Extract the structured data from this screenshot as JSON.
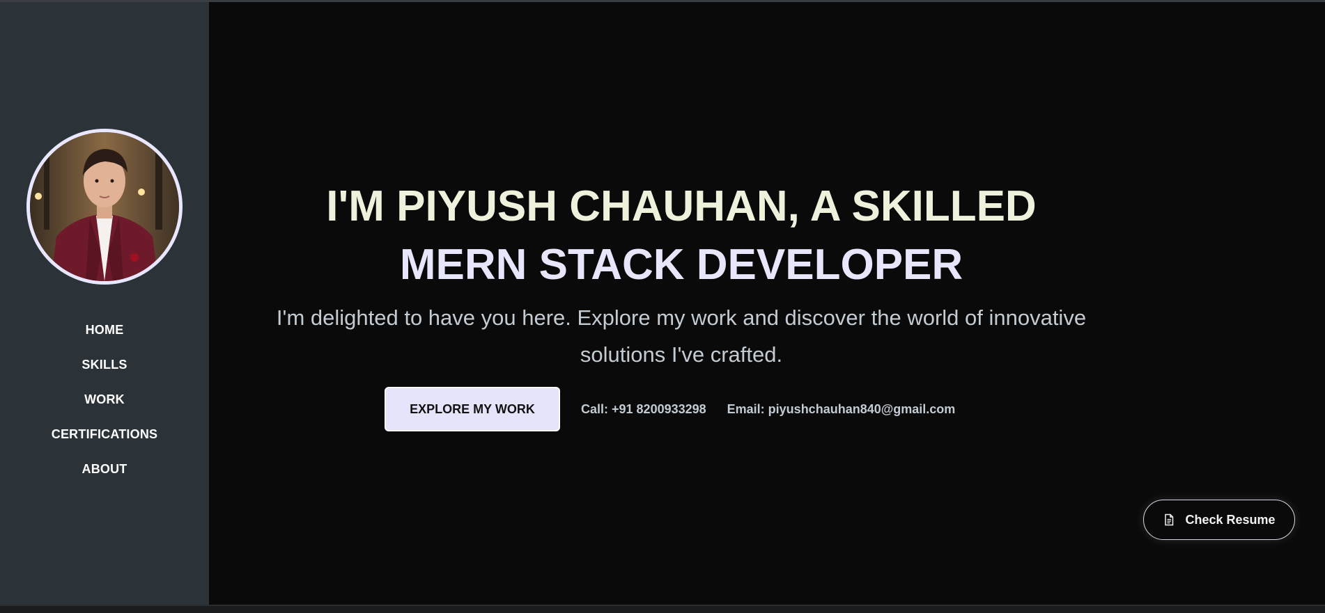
{
  "sidebar": {
    "nav": [
      {
        "label": "HOME"
      },
      {
        "label": "SKILLS"
      },
      {
        "label": "WORK"
      },
      {
        "label": "CERTIFICATIONS"
      },
      {
        "label": "ABOUT"
      }
    ]
  },
  "hero": {
    "title_line1": "I'M PIYUSH CHAUHAN, A SKILLED",
    "title_line2": "MERN STACK DEVELOPER",
    "subtitle": "I'm delighted to have you here. Explore my work and discover the world of innovative solutions I've crafted.",
    "cta_label": "EXPLORE MY WORK",
    "call_text": "Call: +91 8200933298",
    "email_text": "Email: piyushchauhan840@gmail.com"
  },
  "resume": {
    "label": "Check Resume",
    "icon": "document-icon"
  },
  "colors": {
    "background": "#0a0a0a",
    "sidebar": "#2b3339",
    "accent": "#e6e4fb",
    "title_line1": "#eef2dd",
    "text_muted": "#c3cbd3"
  }
}
